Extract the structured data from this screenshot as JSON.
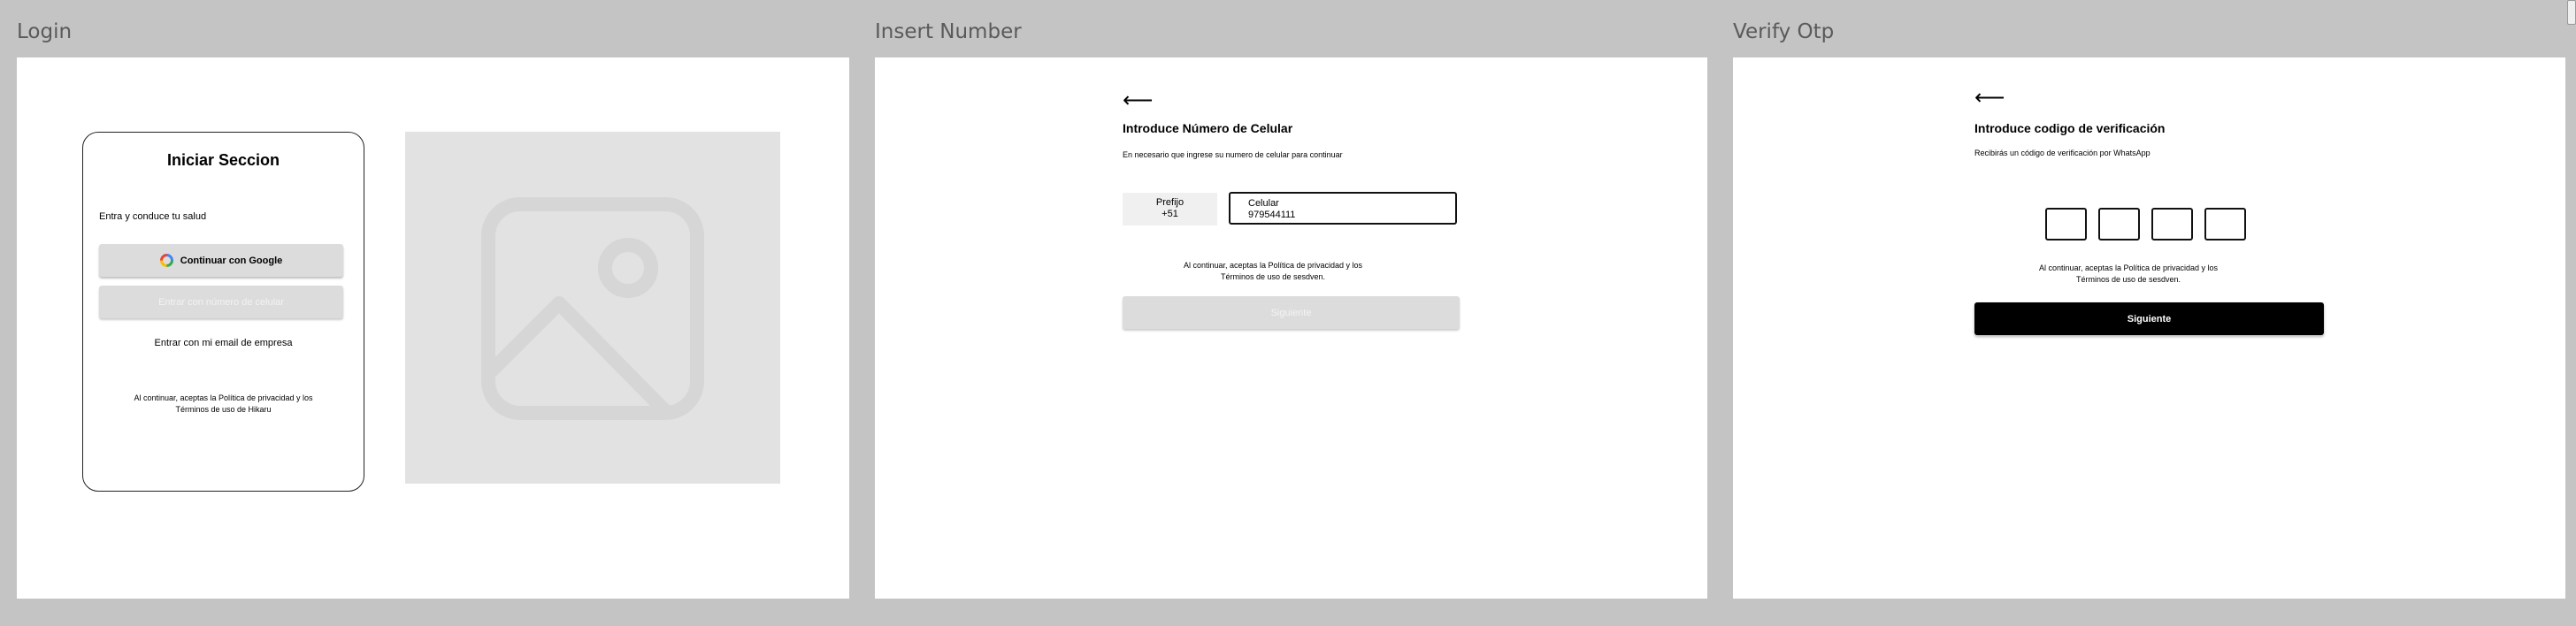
{
  "frames": {
    "login": {
      "label": "Login",
      "card_title": "Iniciar Seccion",
      "subtitle": "Entra y conduce tu salud",
      "google_button": "Continuar con Google",
      "phone_button": "Entrar con número de celular",
      "email_link": "Entrar con mi email de empresa",
      "legal_line1": "Al continuar, aceptas la Política de privacidad y los",
      "legal_line2": "Términos de uso de Hikaru"
    },
    "insert_number": {
      "label": "Insert Number",
      "back_icon": "arrow-left-icon",
      "title": "Introduce Número de Celular",
      "description": "En necesario que ingrese su numero  de celular para continuar",
      "prefix_label": "Prefijo",
      "prefix_value": "+51",
      "phone_label": "Celular",
      "phone_value": "979544111",
      "legal_line1": "Al continuar, aceptas la Política de privacidad y los",
      "legal_line2": "Términos de uso de sesdven.",
      "next_button": "Siguiente"
    },
    "verify_otp": {
      "label": "Verify Otp",
      "back_icon": "arrow-left-icon",
      "title": "Introduce codigo de verificación",
      "description": "Recibirás un código de verificación por WhatsApp",
      "otp_digits": [
        "",
        "",
        "",
        ""
      ],
      "legal_line1": "Al continuar, aceptas la Política de privacidad y los",
      "legal_line2": "Términos de uso de sesdven.",
      "next_button": "Siguiente"
    }
  },
  "colors": {
    "canvas": "#c4c4c4",
    "frame": "#ffffff",
    "primary_button": "#000000",
    "disabled_button": "#dcdcdc",
    "placeholder": "#e2e2e2"
  }
}
